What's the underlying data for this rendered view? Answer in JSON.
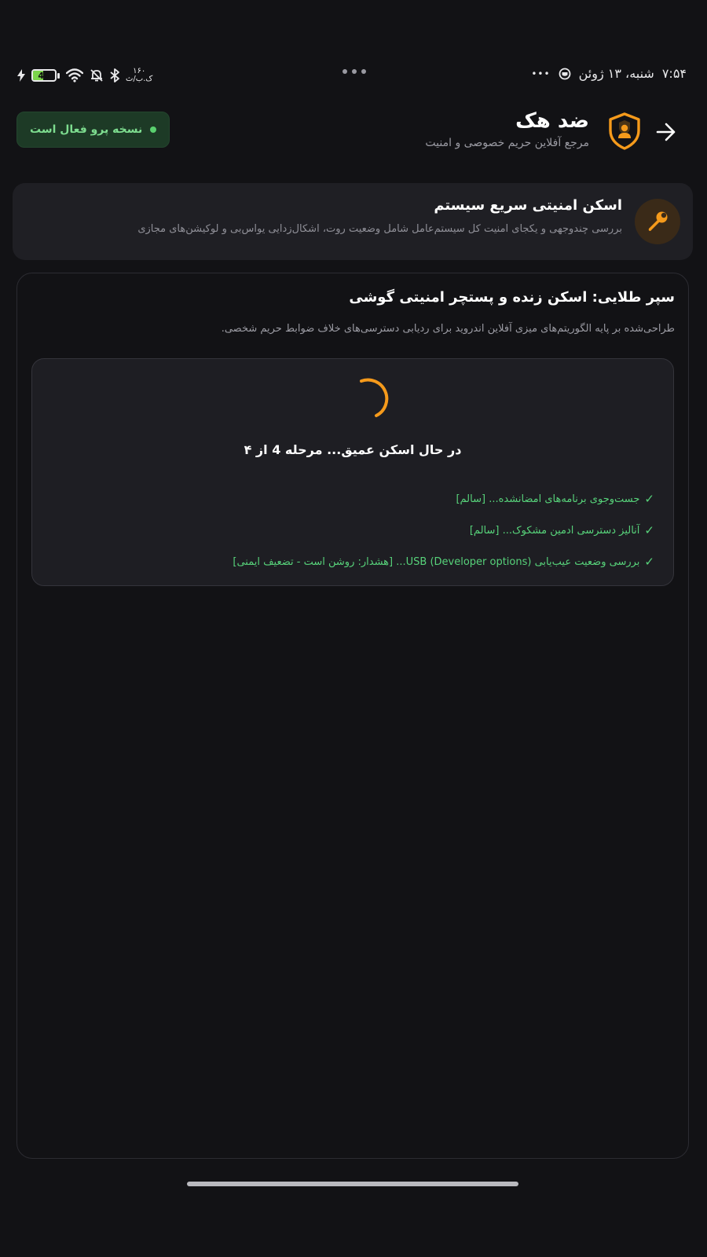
{
  "status_bar": {
    "time": "۷:۵۴",
    "date": "شنبه، ۱۳ ژوئن",
    "more_dots": "•••",
    "battery_level": "46",
    "speed_value": "۱۶۰",
    "speed_unit": "ک.ب/ث"
  },
  "header": {
    "title": "ضد هک",
    "subtitle": "مرجع آفلاین حریم خصوصی و امنیت",
    "pro_badge": "نسخه پرو فعال است"
  },
  "quick_scan": {
    "title": "اسکن امنیتی سریع سیستم",
    "description": "بررسی چندوجهی و یکجای امنیت کل سیستم‌عامل شامل وضعیت روت، اشکال‌زدایی یو‌اس‌بی و لوکیشن‌های مجازی"
  },
  "golden_shield": {
    "title": "سپر طلایی: اسکن زنده و پستچر امنیتی گوشی",
    "description": "طراحی‌شده بر پایه الگوریتم‌های میزی آفلاین اندروید برای ردیابی دسترسی‌های خلاف ضوابط حریم شخصی.",
    "scan_status": "در حال اسکن عمیق... مرحله 4 از ۴",
    "log_check_mark": "✓",
    "logs": [
      "جست‌وجوی برنامه‌های امضانشده... [سالم]",
      "آنالیز دسترسی ادمین مشکوک... [سالم]",
      "بررسی وضعیت عیب‌یابی USB (Developer options)... [هشدار: روشن است - تضعیف ایمنی]"
    ]
  },
  "colors": {
    "background": "#121215",
    "accent_orange": "#f59a1b",
    "success_green": "#57d27a",
    "card": "#1f1f24"
  },
  "icons": [
    "back-arrow-icon",
    "shield-icon",
    "wrench-icon",
    "spinner-icon",
    "wifi-icon",
    "bluetooth-icon",
    "bell-off-icon",
    "charging-icon",
    "battery-icon"
  ]
}
